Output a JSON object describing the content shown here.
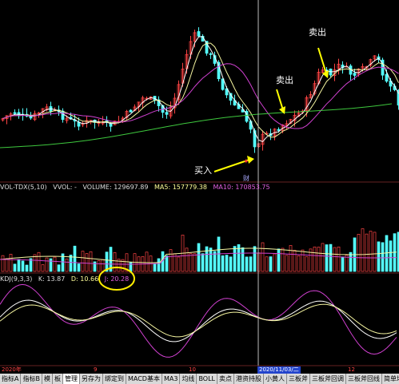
{
  "colors": {
    "up": "#54ffff",
    "down": "#ff4444",
    "ma_white": "#ffffff",
    "ma_yellow": "#f5f5a0",
    "ma_purple": "#d040d0",
    "ma_green": "#3ec83e",
    "crosshair": "#bbbbbb",
    "highlight_circle": "#ffee00",
    "arrow_yellow": "#ffff00"
  },
  "annotations": {
    "sell1": "卖出",
    "sell2": "卖出",
    "buy": "买入",
    "cai": "财"
  },
  "volume_header": {
    "name": "VOL-TDX(5,10)",
    "vvol": "VVOL: -",
    "volume": "VOLUME: 129697.89",
    "ma5": "MA5: 157779.38",
    "ma10": "MA10: 170853.75"
  },
  "kdj_header": {
    "name": "KDJ(9,3,3)",
    "k": "K: 13.87",
    "d": "D: 10.66",
    "j": "J: 20.28"
  },
  "date_axis": {
    "left": "2020年",
    "m9": "9",
    "m10": "10",
    "cursor": "2020/11/03/二",
    "m12": "12"
  },
  "tabs": [
    "指标A",
    "指标B",
    "模",
    "板",
    "管理",
    "另存为",
    "绑定到",
    "MACD基本",
    "MA3",
    "均线",
    "BOLL",
    "卖点",
    "港资持股",
    "小黄人",
    "三板斧",
    "三板斧回调",
    "三板斧回线",
    "简单均线"
  ],
  "active_tab": "管理"
}
